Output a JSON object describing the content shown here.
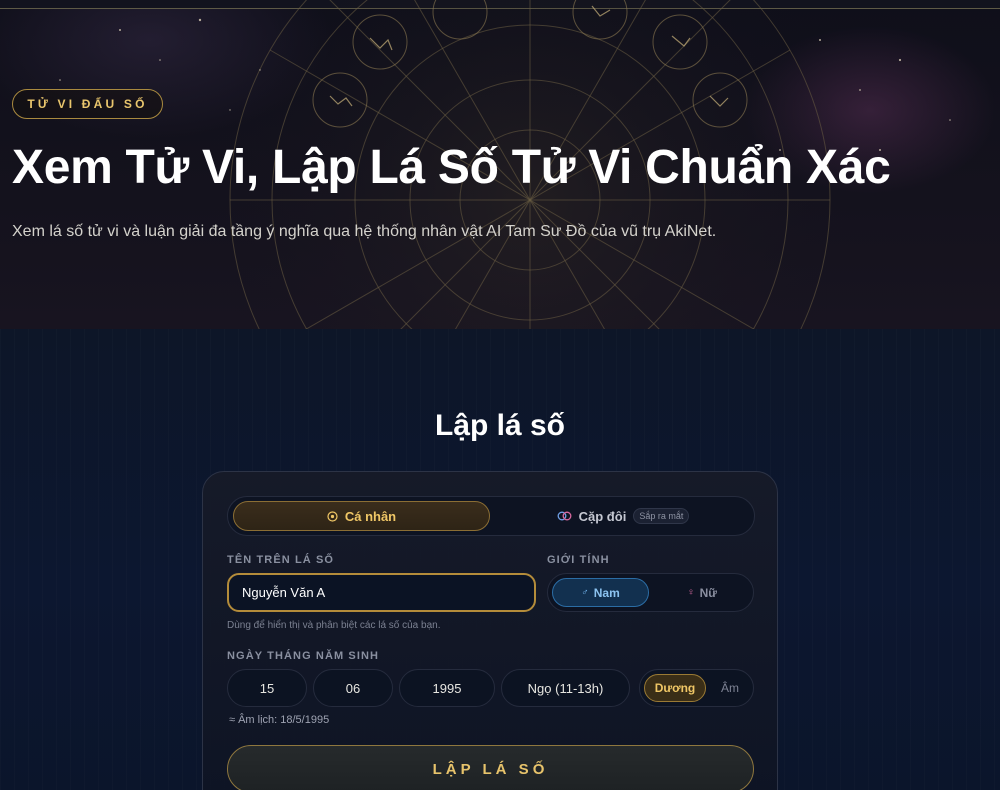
{
  "hero": {
    "badge": "TỬ VI ĐẨU SỐ",
    "title": "Xem Tử Vi, Lập Lá Số Tử Vi Chuẩn Xác",
    "subtitle": "Xem lá số tử vi và luận giải đa tầng ý nghĩa qua hệ thống nhân vật AI Tam Sư Đồ của vũ trụ AkiNet."
  },
  "form": {
    "title": "Lập lá số",
    "mode_tabs": [
      {
        "label": "Cá nhân",
        "icon": "sun-circle-icon",
        "active": true
      },
      {
        "label": "Cặp đôi",
        "icon": "linked-rings-icon",
        "active": false,
        "badge": "Sắp ra mắt"
      }
    ],
    "name_label": "TÊN TRÊN LÁ SỐ",
    "name_value": "Nguyễn Văn A",
    "name_hint": "Dùng để hiển thị và phân biệt các lá số của bạn.",
    "gender_label": "GIỚI TÍNH",
    "gender_options": [
      {
        "label": "Nam",
        "symbol": "♂",
        "active": true
      },
      {
        "label": "Nữ",
        "symbol": "♀",
        "active": false
      }
    ],
    "birth_label": "NGÀY THÁNG NĂM SINH",
    "day": "15",
    "month": "06",
    "year": "1995",
    "hour": "Ngọ (11-13h)",
    "calendar_options": [
      {
        "label": "Dương",
        "active": true
      },
      {
        "label": "Âm",
        "active": false
      }
    ],
    "lunar_note": "≈ Âm lịch: 18/5/1995",
    "submit_label": "LẬP LÁ SỐ"
  },
  "colors": {
    "accent_gold": "#f0c766",
    "background": "#0b1222",
    "male_blue": "#8cc3f0"
  }
}
